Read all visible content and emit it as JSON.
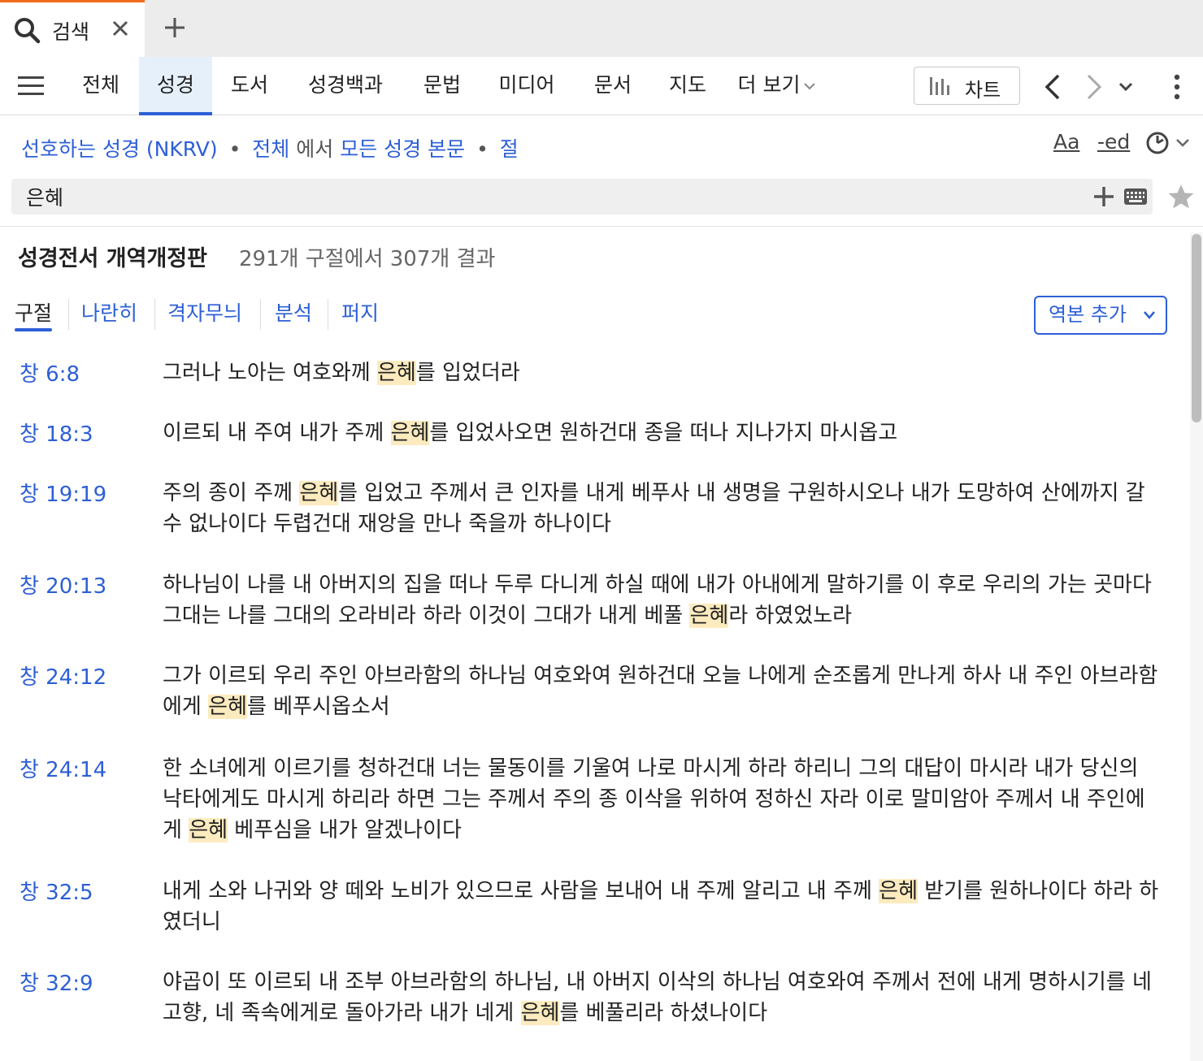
{
  "tab": {
    "label": "검색"
  },
  "nav": {
    "tabs": [
      "전체",
      "성경",
      "도서",
      "성경백과",
      "문법",
      "미디어",
      "문서",
      "지도"
    ],
    "active_tab": "성경",
    "more_label": "더 보기",
    "chart_label": "차트"
  },
  "query": {
    "bible": "선호하는 성경 (NKRV)",
    "sep1": "•",
    "scope": "전체",
    "in": "에서",
    "target": "모든 성경 본문",
    "sep2": "•",
    "unit": "절",
    "aa_label": "Aa",
    "ed_label": "-ed",
    "search_value": "은혜"
  },
  "results": {
    "title": "성경전서 개역개정판",
    "count": "291개 구절에서 307개 결과",
    "view_tabs": [
      "구절",
      "나란히",
      "격자무늬",
      "분석",
      "퍼지"
    ],
    "add_translation": "역본 추가",
    "verses": [
      {
        "ref": "창 6:8",
        "before": "그러나 노아는 여호와께 ",
        "hl": "은혜",
        "after": "를 입었더라"
      },
      {
        "ref": "창 18:3",
        "before": "이르되 내 주여 내가 주께 ",
        "hl": "은혜",
        "after": "를 입었사오면 원하건대 종을 떠나 지나가지 마시옵고"
      },
      {
        "ref": "창 19:19",
        "before": "주의 종이 주께 ",
        "hl": "은혜",
        "after": "를 입었고 주께서 큰 인자를 내게 베푸사 내 생명을 구원하시오나 내가 도망하여 산에까지 갈 수 없나이다 두렵건대 재앙을 만나 죽을까 하나이다"
      },
      {
        "ref": "창 20:13",
        "before": "하나님이 나를 내 아버지의 집을 떠나 두루 다니게 하실 때에 내가 아내에게 말하기를 이 후로 우리의 가는 곳마다 그대는 나를 그대의 오라비라 하라 이것이 그대가 내게 베풀 ",
        "hl": "은혜",
        "after": "라 하였었노라"
      },
      {
        "ref": "창 24:12",
        "before": "그가 이르되 우리 주인 아브라함의 하나님 여호와여 원하건대 오늘 나에게 순조롭게 만나게 하사 내 주인 아브라함에게 ",
        "hl": "은혜",
        "after": "를 베푸시옵소서"
      },
      {
        "ref": "창 24:14",
        "before": "한 소녀에게 이르기를 청하건대 너는 물동이를 기울여 나로 마시게 하라 하리니 그의 대답이 마시라 내가 당신의 낙타에게도 마시게 하리라 하면 그는 주께서 주의 종 이삭을 위하여 정하신 자라 이로 말미암아 주께서 내 주인에게 ",
        "hl": "은혜",
        "after": " 베푸심을 내가 알겠나이다"
      },
      {
        "ref": "창 32:5",
        "before": "내게 소와 나귀와 양 떼와 노비가 있으므로 사람을 보내어 내 주께 알리고 내 주께 ",
        "hl": "은혜",
        "after": " 받기를 원하나이다 하라 하였더니"
      },
      {
        "ref": "창 32:9",
        "before": "야곱이 또 이르되 내 조부 아브라함의 하나님, 내 아버지 이삭의 하나님 여호와여 주께서 전에 내게 명하시기를 네 고향, 네 족속에게로 돌아가라 내가 네게 ",
        "hl": "은혜",
        "after": "를 베풀리라 하셨나이다"
      }
    ]
  },
  "colors": {
    "accent": "#2d5fd6",
    "highlight": "#fcebbf",
    "tab_accent": "#f26b1d"
  }
}
